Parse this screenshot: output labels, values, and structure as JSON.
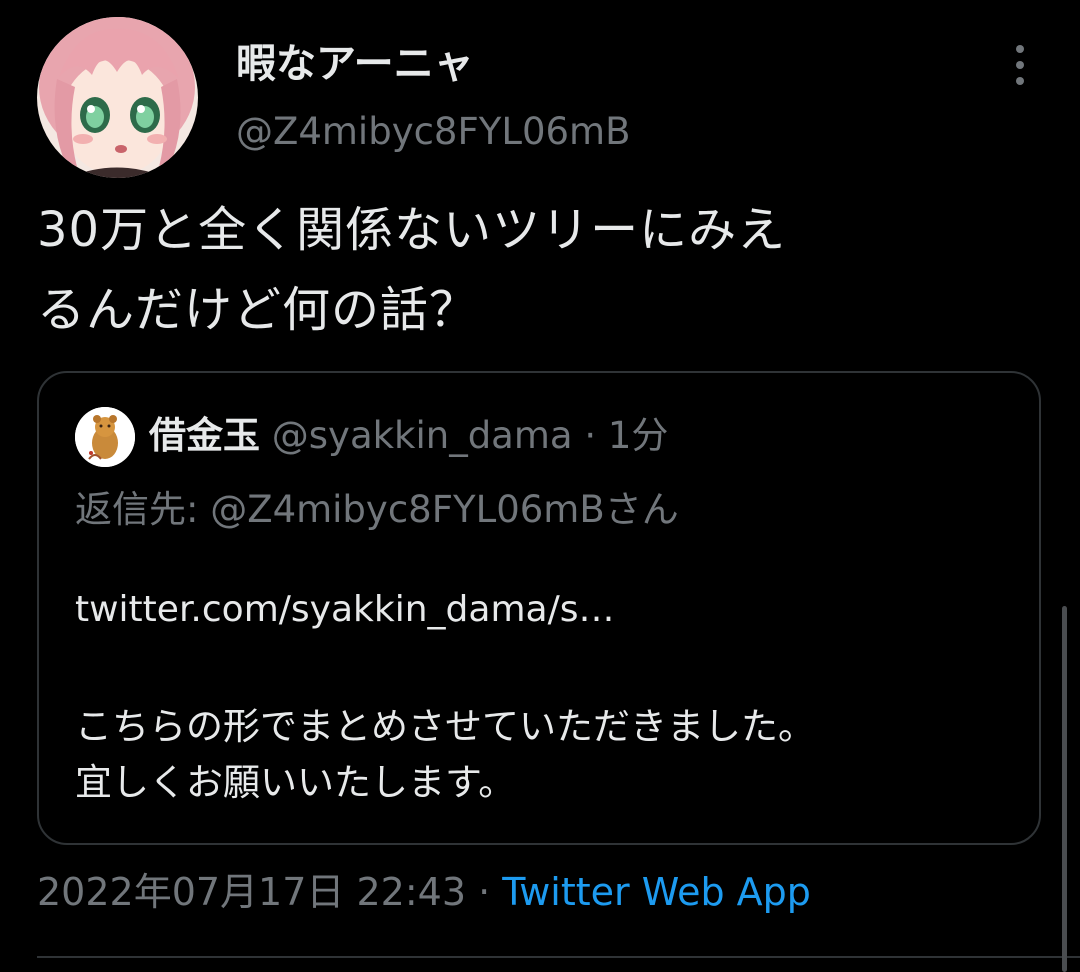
{
  "tweet": {
    "display_name": "暇なアーニャ",
    "handle": "@Z4mibyc8FYL06mB",
    "text_lines": [
      "30万と全く関係ないツリーにみえ",
      "るんだけど何の話？"
    ],
    "more_icon": "more-vertical-icon"
  },
  "quote": {
    "name": "借金玉",
    "handle": "@syakkin_dama",
    "separator": "·",
    "time": "1分",
    "reply_to": "返信先: @Z4mibyc8FYL06mBさん",
    "link": "twitter.com/syakkin_dama/s…",
    "body_lines": [
      "こちらの形でまとめさせていただきました。",
      "宜しくお願いいたします。"
    ]
  },
  "meta": {
    "timestamp": "2022年07月17日 22:43",
    "separator": "·",
    "source": "Twitter Web App"
  },
  "colors": {
    "background": "#000000",
    "text_primary": "#e7e9ea",
    "text_secondary": "#71767b",
    "accent_link": "#1d9bf0",
    "border": "#2f3336"
  }
}
